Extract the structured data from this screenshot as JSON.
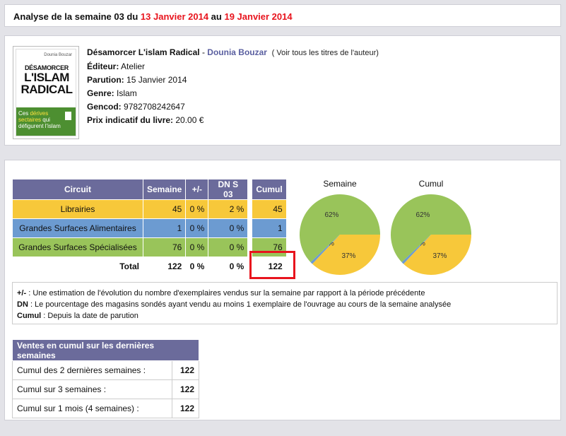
{
  "header": {
    "prefix": "Analyse de la semaine 03 du ",
    "date_from": "13 Janvier 2014",
    "middle": " au ",
    "date_to": "19 Janvier 2014"
  },
  "cover": {
    "author": "Dounia Bouzar",
    "line1": "DÉSAMORCER",
    "line2": "L'ISLAM",
    "line3": "RADICAL",
    "sub1": "Ces",
    "sub2": "dérives",
    "sub3": "sectaires",
    "sub4": "qui",
    "sub5": "défigurent l'islam"
  },
  "book": {
    "title": "Désamorcer L'islam Radical",
    "sep": " - ",
    "author": "Dounia Bouzar",
    "see_all": "( Voir tous les titres de l'auteur)",
    "editeur_label": "Éditeur:",
    "editeur": "Atelier",
    "parution_label": "Parution:",
    "parution": "15 Janvier 2014",
    "genre_label": "Genre:",
    "genre": "Islam",
    "gencod_label": "Gencod:",
    "gencod": "9782708242647",
    "prix_label": "Prix indicatif du livre:",
    "prix": "20.00 €"
  },
  "table": {
    "headers": [
      "Circuit",
      "Semaine",
      "+/-",
      "DN S 03",
      "Cumul"
    ],
    "rows": [
      {
        "circuit": "Librairies",
        "semaine": "45",
        "pm": "0 %",
        "dn": "2 %",
        "cumul": "45"
      },
      {
        "circuit": "Grandes Surfaces Alimentaires",
        "semaine": "1",
        "pm": "0 %",
        "dn": "0 %",
        "cumul": "1"
      },
      {
        "circuit": "Grandes Surfaces Spécialisées",
        "semaine": "76",
        "pm": "0 %",
        "dn": "0 %",
        "cumul": "76"
      }
    ],
    "total": {
      "label": "Total",
      "semaine": "122",
      "pm": "0 %",
      "dn": "0 %",
      "cumul": "122"
    }
  },
  "chart_data": [
    {
      "type": "pie",
      "title": "Semaine",
      "slices": [
        {
          "label": "Librairies",
          "value": 37,
          "color": "#f7c83a"
        },
        {
          "label": "Grandes Surfaces Alimentaires",
          "value": 1,
          "color": "#6c9bd1"
        },
        {
          "label": "Grandes Surfaces Spécialisées",
          "value": 62,
          "color": "#99c45a"
        }
      ],
      "labels": [
        "37%",
        "1%",
        "62%"
      ]
    },
    {
      "type": "pie",
      "title": "Cumul",
      "slices": [
        {
          "label": "Librairies",
          "value": 37,
          "color": "#f7c83a"
        },
        {
          "label": "Grandes Surfaces Alimentaires",
          "value": 1,
          "color": "#6c9bd1"
        },
        {
          "label": "Grandes Surfaces Spécialisées",
          "value": 62,
          "color": "#99c45a"
        }
      ],
      "labels": [
        "37%",
        "1%",
        "62%"
      ]
    }
  ],
  "legend": {
    "pm_label": "+/-",
    "pm_text": " : Une estimation de l'évolution du nombre d'exemplaires vendus sur la semaine par rapport à la période précédente",
    "dn_label": "DN",
    "dn_text": " : Le pourcentage des magasins sondés ayant vendu au moins 1 exemplaire de l'ouvrage au cours de la semaine analysée",
    "cumul_label": "Cumul",
    "cumul_text": " : Depuis la date de parution"
  },
  "cumul_table": {
    "header": "Ventes en cumul sur les dernières semaines",
    "rows": [
      {
        "label": "Cumul des 2 dernières semaines :",
        "value": "122"
      },
      {
        "label": "Cumul sur 3 semaines :",
        "value": "122"
      },
      {
        "label": "Cumul sur 1 mois (4 semaines) :",
        "value": "122"
      }
    ]
  },
  "colors": {
    "accent_red": "#e8141d",
    "header_purple": "#6b6b9b"
  }
}
